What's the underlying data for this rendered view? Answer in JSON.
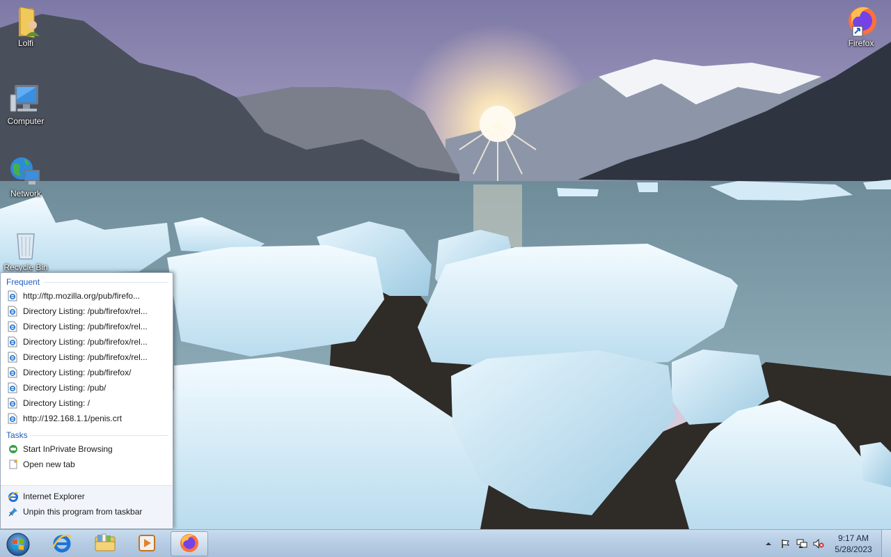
{
  "desktop": {
    "icons": [
      {
        "label": "Lolfi",
        "icon": "user-folder-icon"
      },
      {
        "label": "Computer",
        "icon": "computer-icon"
      },
      {
        "label": "Network",
        "icon": "network-icon"
      },
      {
        "label": "Recycle Bin",
        "icon": "recycle-bin-icon"
      },
      {
        "label": "Firefox",
        "icon": "firefox-icon"
      }
    ]
  },
  "jumplist": {
    "frequent_header": "Frequent",
    "frequent": [
      "http://ftp.mozilla.org/pub/firefo...",
      "Directory Listing: /pub/firefox/rel...",
      "Directory Listing: /pub/firefox/rel...",
      "Directory Listing: /pub/firefox/rel...",
      "Directory Listing: /pub/firefox/rel...",
      "Directory Listing: /pub/firefox/",
      "Directory Listing: /pub/",
      "Directory Listing: /",
      "http://192.168.1.1/penis.crt"
    ],
    "tasks_header": "Tasks",
    "tasks": [
      {
        "label": "Start InPrivate Browsing",
        "icon": "inprivate-icon"
      },
      {
        "label": "Open new tab",
        "icon": "new-tab-icon"
      }
    ],
    "program": {
      "label": "Internet Explorer",
      "icon": "internet-explorer-icon"
    },
    "unpin": {
      "label": "Unpin this program from taskbar",
      "icon": "unpin-icon"
    }
  },
  "taskbar": {
    "pinned": [
      {
        "name": "internet-explorer",
        "icon": "internet-explorer-icon"
      },
      {
        "name": "windows-explorer",
        "icon": "folder-library-icon"
      },
      {
        "name": "media-player",
        "icon": "media-player-icon"
      },
      {
        "name": "firefox",
        "icon": "firefox-icon",
        "active": true
      }
    ],
    "clock": {
      "time": "9:17 AM",
      "date": "5/28/2023"
    }
  }
}
